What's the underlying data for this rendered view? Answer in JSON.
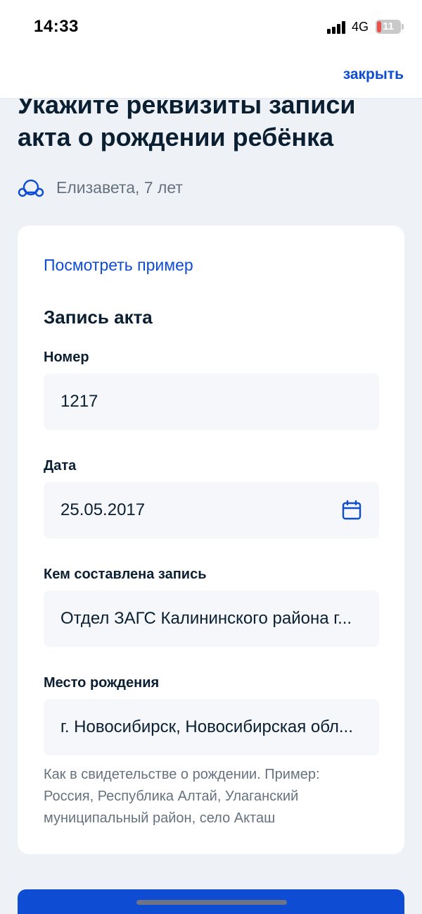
{
  "status_bar": {
    "time": "14:33",
    "network": "4G",
    "battery": "11",
    "battery_color": "#e8524a"
  },
  "header": {
    "close_label": "закрыть"
  },
  "page": {
    "title": "Укажите реквизиты записи акта о рождении ребёнка",
    "child_icon": "child-face-icon",
    "child_name": "Елизавета, 7 лет"
  },
  "card": {
    "example_link": "Посмотреть пример",
    "section_title": "Запись акта",
    "fields": [
      {
        "label": "Номер",
        "value": "1217"
      },
      {
        "label": "Дата",
        "value": "25.05.2017",
        "icon": "calendar-icon"
      },
      {
        "label": "Кем составлена запись",
        "value": "Отдел ЗАГС Калининского района г..."
      },
      {
        "label": "Место рождения",
        "value": "г. Новосибирск, Новосибирская обл..."
      }
    ],
    "hint": "Как в свидетельстве о рождении. Пример: Россия, Республика Алтай, Улаганский муниципальный район, село Акташ"
  },
  "colors": {
    "accent": "#0d4cd3",
    "background": "#eef1f6",
    "text_primary": "#0b1f33",
    "text_secondary": "#66727f"
  }
}
